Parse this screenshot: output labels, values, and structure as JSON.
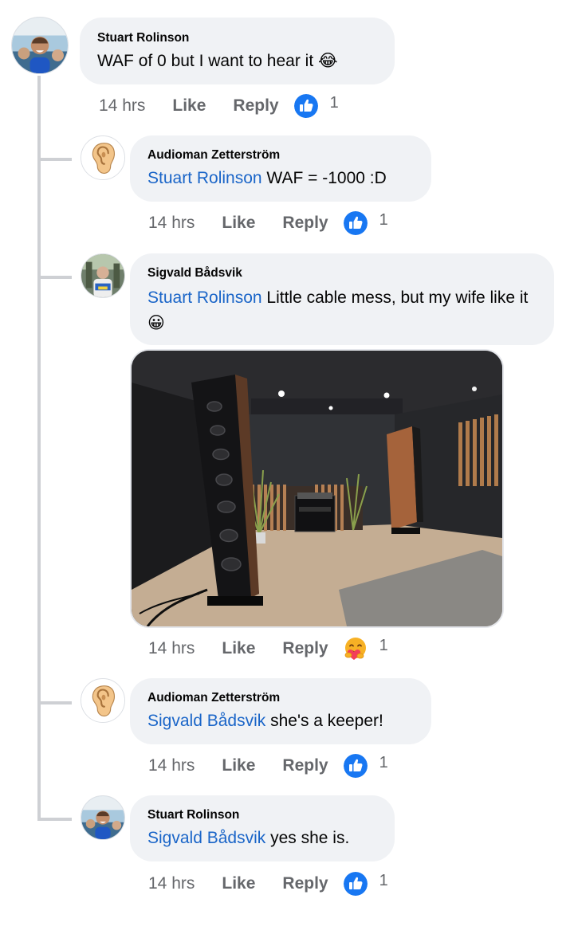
{
  "comment": {
    "author": "Stuart Rolinson",
    "text": "WAF of 0 but I want to hear it ",
    "emoji": "😂",
    "time": "14 hrs",
    "like_label": "Like",
    "reply_label": "Reply",
    "reaction_icon": "like-icon",
    "reaction_count": "1"
  },
  "replies": [
    {
      "author": "Audioman Zetterström",
      "mention": "Stuart Rolinson",
      "text": " WAF = -1000 :D",
      "time": "14 hrs",
      "like_label": "Like",
      "reply_label": "Reply",
      "reaction_icon": "like-icon",
      "reaction_count": "1"
    },
    {
      "author": "Sigvald Bådsvik",
      "mention": "Stuart Rolinson",
      "text": " Little cable mess, but my wife like it",
      "emoji": "😀",
      "image_icon": "listening-room-photo",
      "time": "14 hrs",
      "like_label": "Like",
      "reply_label": "Reply",
      "reaction_icon": "care-icon",
      "reaction_count": "1"
    },
    {
      "author": "Audioman Zetterström",
      "mention": "Sigvald Bådsvik",
      "text": " she's a keeper!",
      "time": "14 hrs",
      "like_label": "Like",
      "reply_label": "Reply",
      "reaction_icon": "like-icon",
      "reaction_count": "1"
    },
    {
      "author": "Stuart Rolinson",
      "mention": "Sigvald Bådsvik",
      "text": " yes she is.",
      "time": "14 hrs",
      "like_label": "Like",
      "reply_label": "Reply",
      "reaction_icon": "like-icon",
      "reaction_count": "1"
    }
  ],
  "colors": {
    "mention": "#1a65c8",
    "bubble": "#f0f2f5",
    "like_blue": "#1877f2",
    "meta_gray": "#65676b",
    "thread_line": "#ced0d4"
  }
}
